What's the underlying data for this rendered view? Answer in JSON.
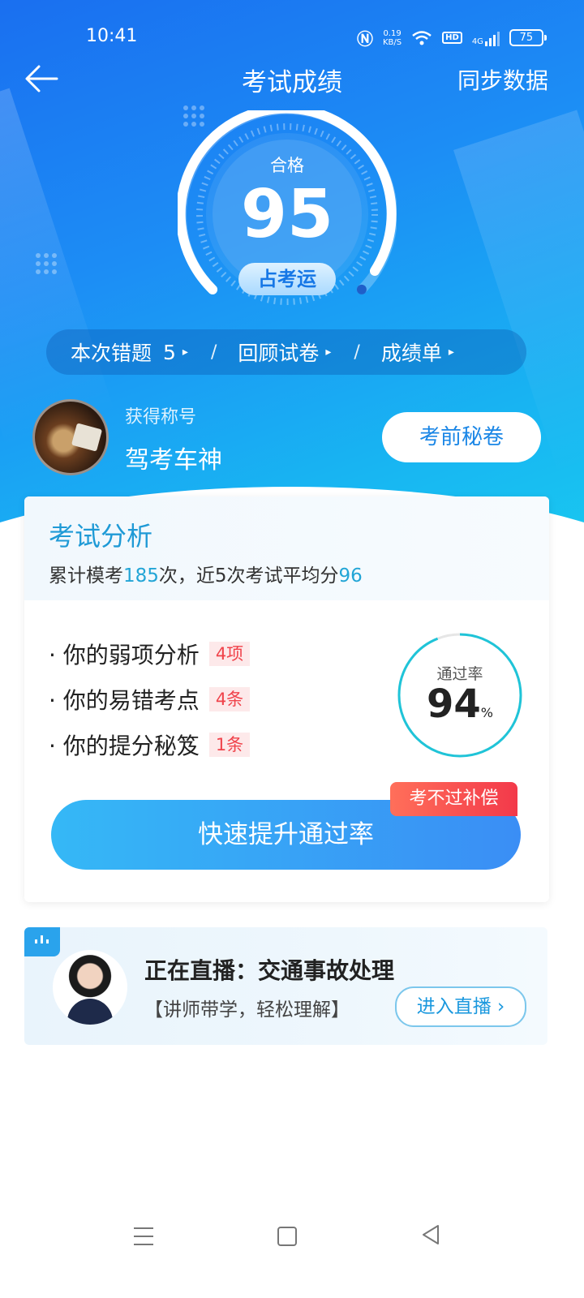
{
  "status_bar": {
    "time": "10:41",
    "net_speed_value": "0.19",
    "net_speed_unit": "KB/S",
    "hd": "HD",
    "signal": "4G",
    "battery": "75",
    "icons": [
      "nfc-icon",
      "wifi-icon",
      "signal-icon",
      "battery-icon"
    ]
  },
  "header": {
    "title": "考试成绩",
    "sync_label": "同步数据",
    "back_icon": "arrow-left-icon"
  },
  "score": {
    "status": "合格",
    "value": "95",
    "fortune_label": "占考运",
    "max": 100
  },
  "quick_links": [
    {
      "label": "本次错题",
      "count": "5"
    },
    {
      "label": "回顾试卷"
    },
    {
      "label": "成绩单"
    }
  ],
  "quick_links_sep": "/",
  "quick_links_arrow": "▸",
  "honor": {
    "label": "获得称号",
    "name": "驾考车神",
    "button": "考前秘卷"
  },
  "analysis": {
    "title": "考试分析",
    "summary_prefix": "累计模考",
    "mock_count": "185",
    "summary_mid": "次，近5次考试平均分",
    "avg_score": "96",
    "items": [
      {
        "label": "· 你的弱项分析",
        "tag": "4项"
      },
      {
        "label": "· 你的易错考点",
        "tag": "4条"
      },
      {
        "label": "· 你的提分秘笈",
        "tag": "1条"
      }
    ],
    "pass_rate_label": "通过率",
    "pass_rate": "94",
    "pass_rate_unit": "%",
    "boost_button": "快速提升通过率",
    "compensation_badge": "考不过补偿"
  },
  "live": {
    "title": "正在直播：交通事故处理",
    "subtitle": "【讲师带学，轻松理解】",
    "button": "进入直播",
    "button_icon": "chevron-right-icon"
  },
  "colors": {
    "hero_top": "#1a6ff0",
    "hero_bottom": "#19c8f0",
    "accent": "#1f9ad6",
    "ring": "#1fc4d8",
    "tag_red": "#f0434b"
  }
}
